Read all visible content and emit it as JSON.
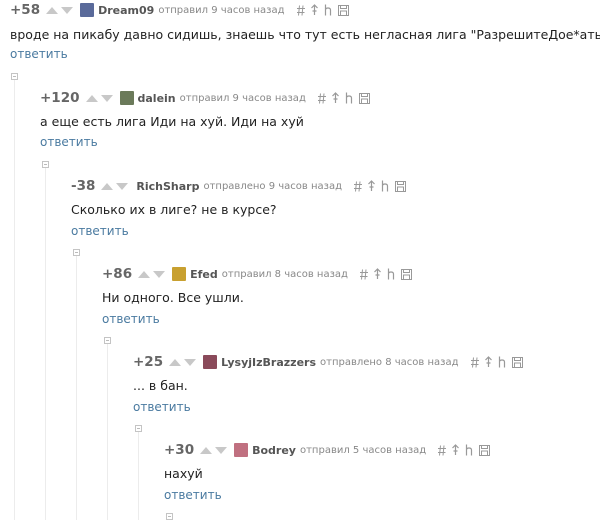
{
  "comments": [
    {
      "rating": "+58",
      "username": "Dream09",
      "action": "отправил 9 часов назад",
      "text": "вроде на пикабу давно сидишь, знаешь что тут есть негласная лига \"РазрешитеДое*аться\"",
      "reply": "ответить",
      "avatar_color": "#5a6a9a"
    },
    {
      "rating": "+120",
      "username": "dalein",
      "action": "отправил 9 часов назад",
      "text": "а еще есть лига Иди на хуй. Иди на хуй",
      "reply": "ответить",
      "avatar_color": "#6b7a5a"
    },
    {
      "rating": "-38",
      "username": "RichSharp",
      "action": "отправлено 9 часов назад",
      "text": "Сколько их в лиге? не в курсе?",
      "reply": "ответить",
      "avatar_color": ""
    },
    {
      "rating": "+86",
      "username": "Efed",
      "action": "отправил 8 часов назад",
      "text": "Ни одного. Все ушли.",
      "reply": "ответить",
      "avatar_color": "#c8a030"
    },
    {
      "rating": "+25",
      "username": "LysyjIzBrazzers",
      "action": "отправлено 8 часов назад",
      "text": "... в бан.",
      "reply": "ответить",
      "avatar_color": "#8a4a5a"
    },
    {
      "rating": "+30",
      "username": "Bodrey",
      "action": "отправил 5 часов назад",
      "text": "нахуй",
      "reply": "ответить",
      "avatar_color": "#c07080"
    }
  ],
  "colors": {
    "reply_link": "#4a7aa0",
    "rating": "#666666",
    "arrows": "#c8c8c8"
  },
  "icons": [
    "comment-link-icon",
    "parent-link-icon",
    "branch-icon",
    "save-icon"
  ]
}
